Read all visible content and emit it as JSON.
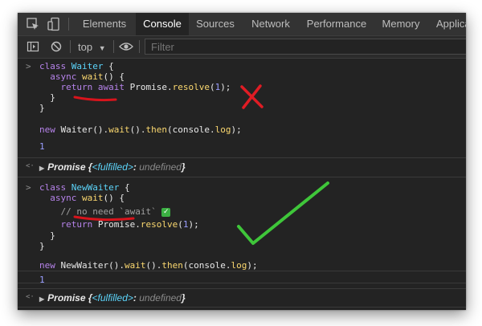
{
  "tabs": [
    "Elements",
    "Console",
    "Sources",
    "Network",
    "Performance",
    "Memory",
    "Applica"
  ],
  "active_tab": "Console",
  "toolbar": {
    "context": "top",
    "filter_placeholder": "Filter"
  },
  "gutter": {
    "input": ">",
    "result": "<·",
    "prompt": ">"
  },
  "console": {
    "block1": {
      "l1a": "class ",
      "l1b": "Waiter",
      "l1c": " {",
      "l2a": "  async ",
      "l2b": "wait",
      "l2c": "() {",
      "l3a": "    return await ",
      "l3b": "Promise",
      "l3c": ".",
      "l3d": "resolve",
      "l3e": "(",
      "l3f": "1",
      "l3g": ");",
      "l4": "  }",
      "l5": "}",
      "l6a": "new ",
      "l6b": "Waiter",
      "l6c": "().",
      "l6d": "wait",
      "l6e": "().",
      "l6f": "then",
      "l6g": "(console.",
      "l6h": "log",
      "l6i": ");"
    },
    "out1": "1",
    "promise1": {
      "name": "Promise",
      "open": " {",
      "state": "<fulfilled>",
      "colon": ": ",
      "value": "undefined",
      "close": "}"
    },
    "block2": {
      "l1a": "class ",
      "l1b": "NewWaiter",
      "l1c": " {",
      "l2a": "  async ",
      "l2b": "wait",
      "l2c": "() {",
      "l3": "    // no need `await` ",
      "l3_emoji": "✓",
      "l4a": "    return ",
      "l4b": "Promise",
      "l4c": ".",
      "l4d": "resolve",
      "l4e": "(",
      "l4f": "1",
      "l4g": ");",
      "l5": "  }",
      "l6": "}",
      "l7a": "new ",
      "l7b": "NewWaiter",
      "l7c": "().",
      "l7d": "wait",
      "l7e": "().",
      "l7f": "then",
      "l7g": "(console.",
      "l7h": "log",
      "l7i": ");"
    },
    "out2": "1",
    "promise2": {
      "name": "Promise",
      "open": " {",
      "state": "<fulfilled>",
      "colon": ": ",
      "value": "undefined",
      "close": "}"
    }
  },
  "colors": {
    "cross": "#e01c24",
    "check": "#3fc63a",
    "underline": "#d8141c"
  }
}
